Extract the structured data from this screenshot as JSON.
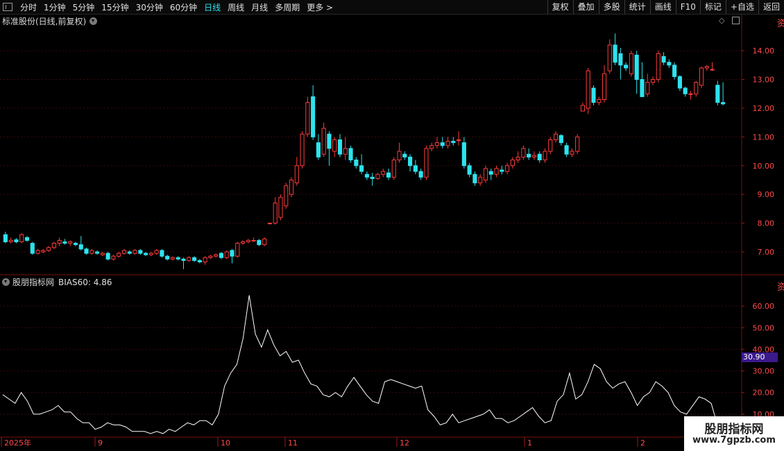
{
  "toolbar": {
    "periods": [
      "分时",
      "1分钟",
      "5分钟",
      "15分钟",
      "30分钟",
      "60分钟",
      "日线",
      "周线",
      "月线",
      "多周期",
      "更多 >"
    ],
    "active_index": 6,
    "right_buttons": [
      "复权",
      "叠加",
      "多股",
      "统计",
      "画线",
      "F10",
      "标记",
      "+自选",
      "返回"
    ]
  },
  "main_chart": {
    "title": "标准股份(日线,前复权)",
    "y_ticks": [
      "14.00",
      "13.00",
      "12.00",
      "11.00",
      "10.00",
      "9.00",
      "8.00",
      "7.00"
    ],
    "ylim": [
      6.3,
      14.8
    ]
  },
  "indicator": {
    "name": "股朋指标网",
    "bias_text": "BIAS60: 4.86",
    "y_ticks": [
      "60.00",
      "50.00",
      "40.00",
      "30.00",
      "20.00",
      "10.00"
    ],
    "ylim": [
      0,
      70
    ],
    "badge": "30.90"
  },
  "x_axis": {
    "labels": [
      "2025年",
      "9",
      "10",
      "11",
      "12",
      "1",
      "2"
    ]
  },
  "watermark": {
    "line1": "股朋指标网",
    "line2": "www.7gpzb.com"
  },
  "colors": {
    "up": "#ff3c3c",
    "down": "#2de3ee",
    "axis": "#a01818",
    "line": "#ffffff"
  },
  "chart_data": [
    {
      "type": "candlestick",
      "title": "标准股份(日线,前复权)",
      "ylim": [
        6.3,
        14.8
      ],
      "candles": [
        [
          7.6,
          7.35,
          7.7,
          7.3
        ],
        [
          7.35,
          7.4,
          7.5,
          7.3
        ],
        [
          7.42,
          7.35,
          7.48,
          7.3
        ],
        [
          7.35,
          7.6,
          7.65,
          7.3
        ],
        [
          7.5,
          7.4,
          7.55,
          7.35
        ],
        [
          7.3,
          6.95,
          7.35,
          6.9
        ],
        [
          6.95,
          7.05,
          7.1,
          6.9
        ],
        [
          7.0,
          7.05,
          7.1,
          6.95
        ],
        [
          7.05,
          7.15,
          7.2,
          7.0
        ],
        [
          7.15,
          7.3,
          7.35,
          7.1
        ],
        [
          7.3,
          7.4,
          7.5,
          7.2
        ],
        [
          7.35,
          7.3,
          7.45,
          7.25
        ],
        [
          7.3,
          7.35,
          7.4,
          7.2
        ],
        [
          7.3,
          7.25,
          7.35,
          7.2
        ],
        [
          7.25,
          7.1,
          7.55,
          7.05
        ],
        [
          7.1,
          6.95,
          7.15,
          6.9
        ],
        [
          6.95,
          7.05,
          7.1,
          6.9
        ],
        [
          7.0,
          6.95,
          7.05,
          6.9
        ],
        [
          6.9,
          6.95,
          7.0,
          6.85
        ],
        [
          6.95,
          6.75,
          7.0,
          6.7
        ],
        [
          6.75,
          6.85,
          6.9,
          6.7
        ],
        [
          6.85,
          6.95,
          7.0,
          6.8
        ],
        [
          6.95,
          7.05,
          7.1,
          6.9
        ],
        [
          7.0,
          6.95,
          7.05,
          6.9
        ],
        [
          6.95,
          7.05,
          7.1,
          6.9
        ],
        [
          7.05,
          6.95,
          7.1,
          6.9
        ],
        [
          6.95,
          6.9,
          7.0,
          6.85
        ],
        [
          6.9,
          6.95,
          7.0,
          6.85
        ],
        [
          6.95,
          7.05,
          7.1,
          6.9
        ],
        [
          7.05,
          6.85,
          7.1,
          6.8
        ],
        [
          6.85,
          6.75,
          6.9,
          6.7
        ],
        [
          6.75,
          6.8,
          6.85,
          6.7
        ],
        [
          6.8,
          6.75,
          6.85,
          6.7
        ],
        [
          6.75,
          6.7,
          6.8,
          6.4
        ],
        [
          6.7,
          6.8,
          6.85,
          6.65
        ],
        [
          6.8,
          6.7,
          6.85,
          6.65
        ],
        [
          6.7,
          6.65,
          6.75,
          6.6
        ],
        [
          6.65,
          6.8,
          6.85,
          6.55
        ],
        [
          6.8,
          6.85,
          6.9,
          6.75
        ],
        [
          6.85,
          6.9,
          6.95,
          6.8
        ],
        [
          6.95,
          6.8,
          7.0,
          6.75
        ],
        [
          6.8,
          7.0,
          7.05,
          6.75
        ],
        [
          7.05,
          6.85,
          7.1,
          6.6
        ],
        [
          6.85,
          7.3,
          7.35,
          6.8
        ],
        [
          7.3,
          7.35,
          7.4,
          7.25
        ],
        [
          7.35,
          7.4,
          7.45,
          7.3
        ],
        [
          7.4,
          7.4,
          7.5,
          7.35
        ],
        [
          7.4,
          7.25,
          7.45,
          7.2
        ],
        [
          7.25,
          7.45,
          7.5,
          7.2
        ],
        [
          7.98,
          8.0,
          8.02,
          7.96
        ],
        [
          8.0,
          8.7,
          8.9,
          7.95
        ],
        [
          8.2,
          8.9,
          9.0,
          8.1
        ],
        [
          8.6,
          9.3,
          9.4,
          8.5
        ],
        [
          9.0,
          9.5,
          9.6,
          8.9
        ],
        [
          9.4,
          10.0,
          10.3,
          9.3
        ],
        [
          10.0,
          11.1,
          11.2,
          9.9
        ],
        [
          11.1,
          12.2,
          12.4,
          11.0
        ],
        [
          12.4,
          11.0,
          12.8,
          10.9
        ],
        [
          10.8,
          10.3,
          11.1,
          10.2
        ],
        [
          10.4,
          11.3,
          11.5,
          10.3
        ],
        [
          11.1,
          10.6,
          11.2,
          10.0
        ],
        [
          10.5,
          10.9,
          11.0,
          10.3
        ],
        [
          10.9,
          10.4,
          11.1,
          10.3
        ],
        [
          10.4,
          10.6,
          11.0,
          10.2
        ],
        [
          10.6,
          10.2,
          10.7,
          10.1
        ],
        [
          10.2,
          10.0,
          10.3,
          9.9
        ],
        [
          10.0,
          9.8,
          10.4,
          9.7
        ],
        [
          9.7,
          9.6,
          9.8,
          9.5
        ],
        [
          9.6,
          9.55,
          9.75,
          9.3
        ],
        [
          9.55,
          9.7,
          9.75,
          9.5
        ],
        [
          9.7,
          9.8,
          9.9,
          9.6
        ],
        [
          9.75,
          9.6,
          9.9,
          9.5
        ],
        [
          9.6,
          10.2,
          10.3,
          9.5
        ],
        [
          10.2,
          10.5,
          10.8,
          10.1
        ],
        [
          10.4,
          10.3,
          10.5,
          10.2
        ],
        [
          10.3,
          10.0,
          10.4,
          9.8
        ],
        [
          10.0,
          9.8,
          10.2,
          9.7
        ],
        [
          9.8,
          9.6,
          9.9,
          9.5
        ],
        [
          9.6,
          10.6,
          10.7,
          9.5
        ],
        [
          10.6,
          10.7,
          10.8,
          10.5
        ],
        [
          10.7,
          10.8,
          11.0,
          10.6
        ],
        [
          10.8,
          10.7,
          11.0,
          10.6
        ],
        [
          10.7,
          10.85,
          11.0,
          10.6
        ],
        [
          10.85,
          10.8,
          11.0,
          10.7
        ],
        [
          10.9,
          10.9,
          11.2,
          10.7
        ],
        [
          10.8,
          10.0,
          11.0,
          9.9
        ],
        [
          10.0,
          9.7,
          10.1,
          9.6
        ],
        [
          9.7,
          9.4,
          9.8,
          9.3
        ],
        [
          9.4,
          9.6,
          9.7,
          9.3
        ],
        [
          9.5,
          9.9,
          10.0,
          9.4
        ],
        [
          9.8,
          9.7,
          9.9,
          9.5
        ],
        [
          9.7,
          9.9,
          10.0,
          9.6
        ],
        [
          9.85,
          9.8,
          10.0,
          9.7
        ],
        [
          9.8,
          10.0,
          10.1,
          9.7
        ],
        [
          10.0,
          10.2,
          10.3,
          9.9
        ],
        [
          10.2,
          10.3,
          10.5,
          10.1
        ],
        [
          10.3,
          10.6,
          10.7,
          10.2
        ],
        [
          10.4,
          10.3,
          10.6,
          10.2
        ],
        [
          10.3,
          10.35,
          10.5,
          10.2
        ],
        [
          10.4,
          10.2,
          10.5,
          10.1
        ],
        [
          10.2,
          10.5,
          10.6,
          10.1
        ],
        [
          10.5,
          10.9,
          11.0,
          10.4
        ],
        [
          10.9,
          11.1,
          11.2,
          10.8
        ],
        [
          11.05,
          10.8,
          11.1,
          10.7
        ],
        [
          10.7,
          10.4,
          10.8,
          10.3
        ],
        [
          10.4,
          10.5,
          10.6,
          10.3
        ],
        [
          10.5,
          11.0,
          11.1,
          10.4
        ],
        [
          11.9,
          12.1,
          12.2,
          11.9
        ],
        [
          12.0,
          13.3,
          13.4,
          11.8
        ],
        [
          12.7,
          12.2,
          12.8,
          12.1
        ],
        [
          12.2,
          12.3,
          12.4,
          12.1
        ],
        [
          12.3,
          13.2,
          13.5,
          12.2
        ],
        [
          13.3,
          14.2,
          14.4,
          13.2
        ],
        [
          14.2,
          13.6,
          14.6,
          13.5
        ],
        [
          13.9,
          13.5,
          14.1,
          13.0
        ],
        [
          13.5,
          13.4,
          13.6,
          13.3
        ],
        [
          13.2,
          13.9,
          14.0,
          13.1
        ],
        [
          13.85,
          13.0,
          14.0,
          12.5
        ],
        [
          13.0,
          12.4,
          13.6,
          12.4
        ],
        [
          12.5,
          12.9,
          13.2,
          12.4
        ],
        [
          12.9,
          13.0,
          13.1,
          12.8
        ],
        [
          13.0,
          13.9,
          14.0,
          12.9
        ],
        [
          13.8,
          13.6,
          13.95,
          13.5
        ],
        [
          13.6,
          13.5,
          13.7,
          13.4
        ],
        [
          13.5,
          13.1,
          13.6,
          13.0
        ],
        [
          13.1,
          12.7,
          13.15,
          12.6
        ],
        [
          12.7,
          12.5,
          12.75,
          12.4
        ],
        [
          12.5,
          12.5,
          12.6,
          12.3
        ],
        [
          12.5,
          12.9,
          12.95,
          12.4
        ],
        [
          12.8,
          13.4,
          13.45,
          12.7
        ],
        [
          13.4,
          13.45,
          13.5,
          13.3
        ],
        [
          13.35,
          13.35,
          13.6,
          13.3
        ],
        [
          12.8,
          12.2,
          12.95,
          12.1
        ],
        [
          12.2,
          12.15,
          12.9,
          12.1
        ]
      ]
    },
    {
      "type": "line",
      "series": [
        {
          "name": "BIAS60",
          "values": [
            19,
            17,
            15,
            20,
            16,
            10,
            10,
            11,
            12,
            14,
            11,
            11,
            8,
            6,
            6,
            3,
            4,
            6,
            5,
            5,
            4,
            2,
            2,
            2,
            1,
            2,
            1,
            3,
            2,
            4,
            6,
            5,
            7,
            7,
            5,
            10,
            23,
            29,
            33,
            45,
            65,
            47,
            41,
            49,
            42,
            37,
            39,
            34,
            35,
            29,
            24,
            23,
            19,
            18,
            20,
            18,
            23,
            27,
            23,
            19,
            16,
            15,
            25,
            26,
            25,
            24,
            23,
            22,
            23,
            12,
            9,
            5,
            6,
            10,
            6,
            7,
            8,
            9,
            10,
            12,
            8,
            8,
            6,
            7,
            9,
            11,
            13,
            9,
            6,
            7,
            16,
            19,
            29,
            17,
            19,
            25,
            33,
            31,
            25,
            22,
            24,
            25,
            20,
            14,
            18,
            20,
            25,
            23,
            20,
            14,
            11,
            10,
            14,
            18,
            17,
            15,
            5
          ]
        }
      ],
      "ylim": [
        0,
        70
      ]
    }
  ]
}
